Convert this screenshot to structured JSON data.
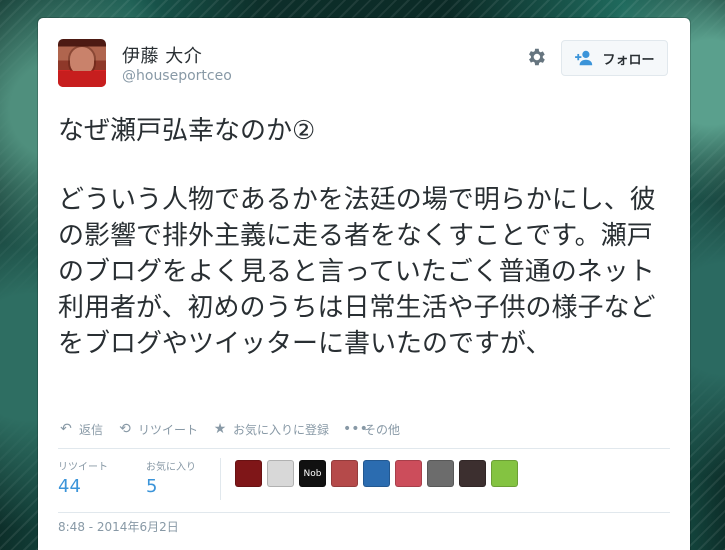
{
  "user": {
    "name": "伊藤 大介",
    "handle": "@houseportceo"
  },
  "header": {
    "follow_label": "フォロー",
    "settings_icon": "gear-icon",
    "follow_icon": "person-plus-icon"
  },
  "tweet": {
    "title": "なぜ瀬戸弘幸なのか②",
    "body": "どういう人物であるかを法廷の場で明らかにし、彼の影響で排外主義に走る者をなくすことです。瀬戸のブログをよく見ると言っていたごく普通のネット利用者が、初めのうちは日常生活や子供の様子などをブログやツイッターに書いたのですが、"
  },
  "actions": [
    {
      "icon": "reply-icon",
      "label": "返信"
    },
    {
      "icon": "retweet-icon",
      "label": "リツイート"
    },
    {
      "icon": "star-icon",
      "label": "お気に入りに登録"
    },
    {
      "icon": "more-icon",
      "label": "その他"
    }
  ],
  "stats": {
    "retweets_label": "リツイート",
    "retweets_count": "44",
    "favorites_label": "お気に入り",
    "favorites_count": "5"
  },
  "avatars": [
    {
      "color": "#7f1618"
    },
    {
      "color": "#d8d8d8"
    },
    {
      "color": "#111111",
      "text": "Nob"
    },
    {
      "color": "#b54a4a"
    },
    {
      "color": "#2b6cb0"
    },
    {
      "color": "#cc4d5b"
    },
    {
      "color": "#6c6c6c"
    },
    {
      "color": "#3c2f2f"
    },
    {
      "color": "#84c341"
    }
  ],
  "timestamp": "8:48 - 2014年6月2日",
  "colors": {
    "accent": "#3b94d9",
    "muted": "#8899a6",
    "text": "#292f33"
  }
}
